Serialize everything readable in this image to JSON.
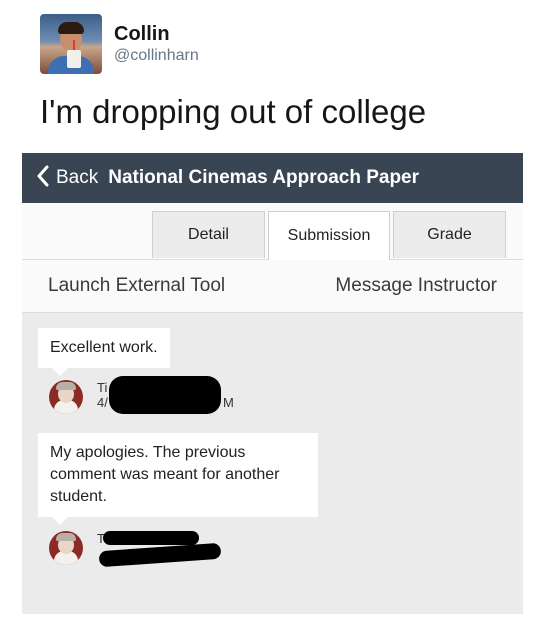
{
  "tweet": {
    "name": "Collin",
    "handle": "@collinharn",
    "text": "I'm dropping out of college"
  },
  "app": {
    "back_label": "Back",
    "title": "National Cinemas Approach Paper",
    "tabs": [
      {
        "label": "Detail"
      },
      {
        "label": "Submission"
      },
      {
        "label": "Grade"
      }
    ],
    "actions": {
      "launch": "Launch External Tool",
      "message": "Message Instructor"
    }
  },
  "comments": [
    {
      "text": "Excellent work.",
      "author_visible": "Ti",
      "meta_visible_start": "4/",
      "meta_visible_end": "M"
    },
    {
      "text": "My apologies. The previous comment was meant for another student.",
      "author_visible": "T"
    }
  ],
  "colors": {
    "navbar": "#394553",
    "page_bg": "#ebebeb"
  }
}
